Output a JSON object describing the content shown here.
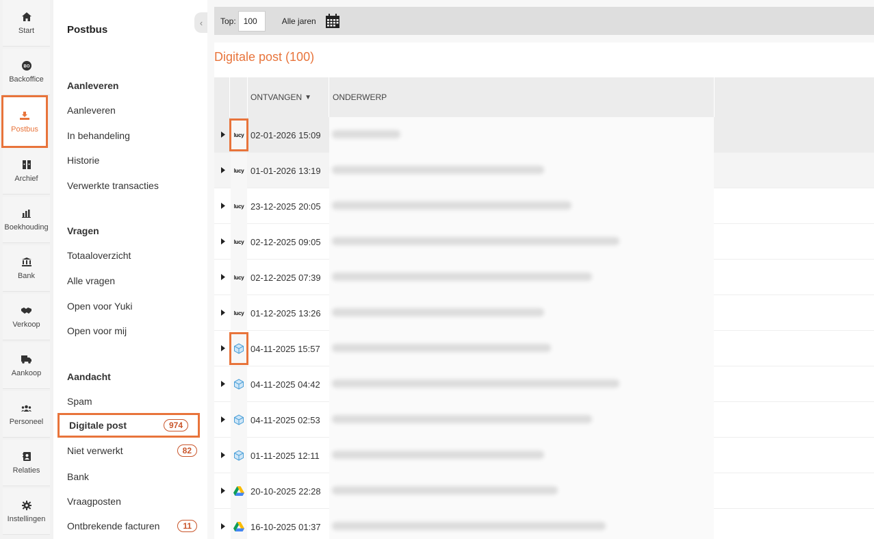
{
  "rail": [
    {
      "label": "Start",
      "icon": "home-icon"
    },
    {
      "label": "Backoffice",
      "icon": "bo-icon"
    },
    {
      "label": "Postbus",
      "icon": "inbox-icon",
      "active": true
    },
    {
      "label": "Archief",
      "icon": "archive-icon"
    },
    {
      "label": "Boekhouding",
      "icon": "bar-chart-icon"
    },
    {
      "label": "Bank",
      "icon": "bank-icon"
    },
    {
      "label": "Verkoop",
      "icon": "handshake-icon"
    },
    {
      "label": "Aankoop",
      "icon": "truck-icon"
    },
    {
      "label": "Personeel",
      "icon": "people-icon"
    },
    {
      "label": "Relaties",
      "icon": "contact-book-icon"
    },
    {
      "label": "Instellingen",
      "icon": "gear-icon"
    }
  ],
  "subnav": {
    "title": "Postbus",
    "sections": {
      "aanleveren": {
        "heading": "Aanleveren",
        "items": [
          "Aanleveren",
          "In behandeling",
          "Historie",
          "Verwerkte transacties"
        ]
      },
      "vragen": {
        "heading": "Vragen",
        "items": [
          "Totaaloverzicht",
          "Alle vragen",
          "Open voor Yuki",
          "Open voor mij"
        ]
      },
      "aandacht": {
        "heading": "Aandacht",
        "items": [
          {
            "label": "Spam",
            "badge": ""
          },
          {
            "label": "Digitale post",
            "badge": "974"
          },
          {
            "label": "Niet verwerkt",
            "badge": "82"
          },
          {
            "label": "Bank",
            "badge": ""
          },
          {
            "label": "Vraagposten",
            "badge": ""
          },
          {
            "label": "Ontbrekende facturen",
            "badge": "11"
          }
        ]
      }
    }
  },
  "toolbar": {
    "top_label": "Top:",
    "top_value": "100",
    "years_label": "Alle jaren"
  },
  "list": {
    "title": "Digitale post (100)",
    "columns": {
      "received": "ONTVANGEN",
      "subject": "ONDERWERP"
    },
    "rows": [
      {
        "source": "lucy",
        "date": "02-01-2026 15:09"
      },
      {
        "source": "lucy",
        "date": "01-01-2026 13:19"
      },
      {
        "source": "lucy",
        "date": "23-12-2025 20:05"
      },
      {
        "source": "lucy",
        "date": "02-12-2025 09:05"
      },
      {
        "source": "lucy",
        "date": "02-12-2025 07:39"
      },
      {
        "source": "lucy",
        "date": "01-12-2025 13:26"
      },
      {
        "source": "cube",
        "date": "04-11-2025 15:57"
      },
      {
        "source": "cube",
        "date": "04-11-2025 04:42"
      },
      {
        "source": "cube",
        "date": "04-11-2025 02:53"
      },
      {
        "source": "cube",
        "date": "01-11-2025 12:11"
      },
      {
        "source": "drive",
        "date": "20-10-2025 22:28"
      },
      {
        "source": "drive",
        "date": "16-10-2025 01:37"
      }
    ]
  },
  "colors": {
    "accent": "#e8743b",
    "badge": "#c9552a"
  }
}
